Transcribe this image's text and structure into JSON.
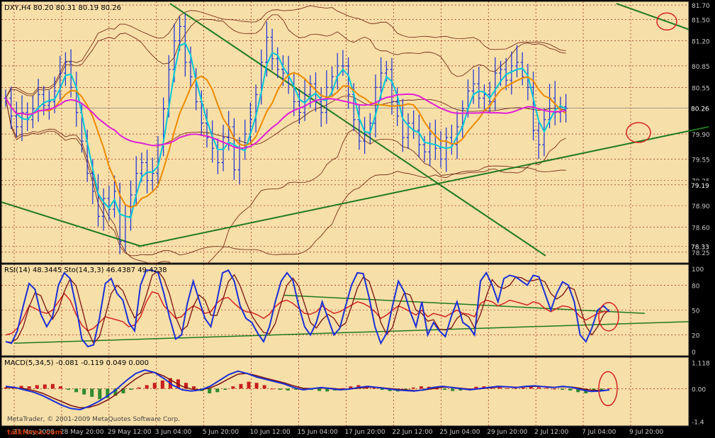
{
  "colors": {
    "background": "#f7dfa8",
    "axis": "#2a2a2a",
    "grid": "#8b0000",
    "candle": "#1a2ed6",
    "trendline": "#1f7a1f",
    "ma_fast": "#00c8d6",
    "ma_mid": "#ee8a00",
    "ma_slow": "#e020d8",
    "bands": "#6a1a0a",
    "rsi": "#d42222",
    "stoch_main": "#1a2ed6",
    "stoch_signal": "#7a1010",
    "macd_up": "#c81e1e",
    "macd_down": "#2e8b2e",
    "annotation": "#d42222",
    "current_price_tag": "#000000"
  },
  "chart_data": [
    {
      "type": "line",
      "panel": "price",
      "title": "DXY,H4  80.20 80.31 80.19 80.26",
      "symbol": "DXY",
      "timeframe": "H4",
      "ohlc": {
        "open": 80.2,
        "high": 80.31,
        "low": 80.19,
        "close": 80.26
      },
      "ylim": [
        78.1,
        81.75
      ],
      "y_ticks": [
        "81.70",
        "81.50",
        "81.20",
        "80.85",
        "80.55",
        "80.26",
        "79.90",
        "79.55",
        "79.25",
        "79.19",
        "78.90",
        "78.60",
        "78.33",
        "78.25"
      ],
      "current_price": "80.26",
      "marked_levels": [
        "79.19",
        "78.33"
      ],
      "x_labels": [
        "27 May 2009",
        "28 May 20:00",
        "29 May 12:00",
        "3 Jun 04:00",
        "5 Jun 20:00",
        "10 Jun 12:00",
        "15 Jun 04:00",
        "17 Jun 20:00",
        "22 Jun 12:00",
        "25 Jun 04:00",
        "29 Jun 20:00",
        "2 Jul 12:00",
        "7 Jul 04:00",
        "9 Jul 20:00"
      ],
      "x": [
        0,
        2,
        4,
        6,
        8,
        10,
        12,
        14,
        16,
        18,
        20,
        22,
        24,
        26,
        28,
        30,
        32,
        34,
        36,
        38,
        40,
        42,
        44,
        46,
        48,
        50,
        52,
        54,
        56,
        58,
        60,
        62,
        64,
        66,
        68,
        70,
        72,
        74,
        76,
        78,
        80,
        82,
        84,
        86,
        88,
        90,
        92,
        94,
        96,
        98,
        100,
        102,
        104,
        106,
        108,
        110,
        112,
        114,
        116,
        118,
        120,
        122,
        124,
        126,
        128,
        130,
        132,
        134,
        136,
        138,
        140,
        142,
        144,
        146,
        148,
        150,
        152,
        154,
        156,
        158,
        160,
        162,
        164,
        166,
        168,
        170,
        172,
        174,
        176,
        178,
        180,
        182,
        184,
        186,
        188,
        190,
        192,
        194,
        196,
        198,
        200,
        202,
        204,
        206,
        208,
        210,
        212,
        214,
        216,
        218,
        220,
        222
      ],
      "close": [
        80.4,
        80.15,
        80.0,
        80.2,
        80.1,
        80.25,
        80.45,
        80.3,
        80.35,
        80.5,
        80.75,
        80.9,
        80.55,
        80.2,
        79.8,
        79.35,
        79.1,
        78.75,
        79.0,
        78.85,
        79.1,
        78.4,
        78.75,
        79.05,
        79.35,
        79.5,
        79.25,
        79.35,
        79.75,
        80.25,
        80.8,
        81.2,
        81.4,
        80.9,
        80.7,
        80.35,
        80.05,
        79.85,
        79.7,
        79.5,
        79.85,
        80.0,
        79.4,
        79.7,
        79.9,
        80.1,
        80.45,
        80.9,
        81.25,
        80.95,
        80.8,
        80.75,
        80.6,
        80.35,
        80.2,
        80.45,
        80.6,
        80.35,
        80.2,
        80.55,
        80.7,
        80.85,
        80.85,
        80.45,
        80.1,
        79.8,
        79.9,
        80.05,
        80.55,
        80.75,
        80.8,
        80.35,
        80.15,
        79.85,
        80.05,
        79.95,
        79.75,
        79.65,
        79.9,
        79.7,
        79.55,
        79.85,
        79.75,
        80.0,
        80.25,
        80.5,
        80.6,
        80.4,
        80.45,
        80.35,
        80.75,
        80.8,
        80.65,
        80.85,
        80.9,
        80.7,
        80.55,
        79.95,
        79.75,
        80.1,
        80.4,
        80.2,
        80.28,
        80.26
      ],
      "annotations": [
        "circle at 81.50",
        "circle at 79.90"
      ],
      "trendlines": [
        "descending resistance from 81.70 through 79.55",
        "ascending support from 78.33 through 80.00",
        "descending line 78.95 to 77.90"
      ]
    },
    {
      "type": "line",
      "panel": "oscillator",
      "title": "RSI(14) 48.3445  Sto(14,3,3) 46.4387 49.4238",
      "rsi_period": 14,
      "rsi_value": 48.3445,
      "stoch_params": "14,3,3",
      "stoch_main_value": 46.4387,
      "stoch_signal_value": 49.4238,
      "ylim": [
        0,
        100
      ],
      "y_ticks": [
        "100",
        "80",
        "50",
        "20",
        "0"
      ],
      "levels": [
        80,
        50,
        20
      ],
      "stoch": [
        12,
        10,
        25,
        55,
        82,
        75,
        45,
        30,
        42,
        80,
        95,
        88,
        55,
        15,
        6,
        8,
        40,
        82,
        88,
        70,
        62,
        35,
        25,
        80,
        98,
        98,
        95,
        70,
        40,
        15,
        20,
        58,
        85,
        62,
        40,
        30,
        60,
        95,
        98,
        85,
        55,
        40,
        35,
        22,
        12,
        30,
        60,
        85,
        95,
        86,
        55,
        30,
        20,
        35,
        60,
        40,
        20,
        28,
        55,
        80,
        95,
        94,
        65,
        30,
        10,
        22,
        55,
        85,
        72,
        48,
        30,
        60,
        20,
        35,
        25,
        18,
        42,
        60,
        35,
        30,
        20,
        85,
        95,
        80,
        60,
        88,
        92,
        90,
        85,
        80,
        92,
        90,
        70,
        50,
        70,
        84,
        80,
        60,
        20,
        12,
        28,
        50,
        55,
        48
      ],
      "rsi": [
        20,
        22,
        28,
        40,
        55,
        52,
        48,
        46,
        50,
        60,
        70,
        62,
        45,
        32,
        25,
        28,
        35,
        42,
        40,
        38,
        36,
        30,
        32,
        42,
        60,
        72,
        70,
        55,
        48,
        40,
        42,
        50,
        55,
        52,
        46,
        48,
        58,
        64,
        65,
        58,
        52,
        48,
        47,
        44,
        40,
        45,
        54,
        60,
        62,
        58,
        52,
        46,
        45,
        48,
        55,
        50,
        46,
        48,
        52,
        56,
        60,
        58,
        54,
        48,
        40,
        44,
        50,
        55,
        52,
        48,
        44,
        50,
        42,
        46,
        44,
        42,
        46,
        50,
        46,
        45,
        42,
        58,
        62,
        60,
        55,
        58,
        62,
        60,
        58,
        56,
        60,
        58,
        52,
        48,
        52,
        55,
        54,
        50,
        42,
        38,
        42,
        46,
        48,
        48
      ],
      "annotation": "circle near 48"
    },
    {
      "type": "bar",
      "panel": "macd",
      "title": "MACD(5,34,5) -0.081 -0.119 0.049 0.000",
      "macd_params": "5,34,5",
      "values_shown": [
        "-0.081",
        "-0.119",
        "0.049",
        "0.000"
      ],
      "ylim": [
        -1.6,
        1.35
      ],
      "y_ticks": [
        "1.118",
        "0.00",
        "-1.4"
      ],
      "histogram": [
        0.05,
        0.08,
        0.12,
        0.1,
        0.15,
        0.18,
        0.2,
        0.1,
        -0.05,
        -0.15,
        -0.25,
        -0.35,
        -0.45,
        -0.4,
        -0.3,
        -0.2,
        -0.05,
        0.05,
        0.15,
        0.25,
        0.35,
        0.45,
        0.4,
        0.25,
        0.1,
        -0.1,
        -0.2,
        -0.15,
        -0.05,
        0.1,
        0.2,
        0.3,
        0.25,
        0.15,
        0.0,
        -0.05,
        -0.08,
        -0.05,
        -0.02,
        -0.05,
        -0.1,
        -0.12,
        -0.08,
        0.02,
        0.1,
        0.15,
        0.12,
        0.05,
        -0.05,
        -0.1,
        -0.12,
        -0.05,
        0.05,
        0.1,
        0.08,
        0.0,
        -0.05,
        -0.1,
        -0.08,
        0.0,
        0.08,
        0.1,
        0.08,
        0.05,
        0.02,
        0.04,
        0.05,
        0.08,
        0.06,
        0.03,
        0.0,
        -0.05,
        -0.08,
        -0.15,
        -0.2,
        -0.12,
        -0.08,
        0.02
      ],
      "macd_line": [
        0.1,
        0.05,
        -0.05,
        -0.15,
        -0.3,
        -0.5,
        -0.7,
        -0.85,
        -0.9,
        -0.75,
        -0.55,
        -0.3,
        0.0,
        0.35,
        0.65,
        0.8,
        0.7,
        0.45,
        0.15,
        -0.05,
        -0.1,
        -0.05,
        0.1,
        0.35,
        0.6,
        0.75,
        0.65,
        0.5,
        0.4,
        0.3,
        0.2,
        0.05,
        -0.05,
        0.0,
        0.05,
        0.0,
        -0.05,
        -0.02,
        0.05,
        0.1,
        0.05,
        0.0,
        -0.05,
        -0.08,
        -0.1,
        -0.05,
        0.05,
        0.1,
        0.05,
        0.0,
        -0.05,
        0.0,
        0.05,
        0.1,
        0.08,
        0.05,
        0.1,
        0.12,
        0.08,
        0.05,
        0.1,
        0.05,
        -0.05,
        -0.12,
        -0.1,
        -0.05
      ],
      "signal_line": [
        0.05,
        0.04,
        0.0,
        -0.08,
        -0.2,
        -0.38,
        -0.55,
        -0.72,
        -0.82,
        -0.8,
        -0.68,
        -0.48,
        -0.22,
        0.12,
        0.42,
        0.65,
        0.7,
        0.55,
        0.32,
        0.1,
        -0.02,
        -0.05,
        0.03,
        0.2,
        0.42,
        0.62,
        0.66,
        0.56,
        0.45,
        0.35,
        0.25,
        0.12,
        0.02,
        0.0,
        0.03,
        0.02,
        -0.02,
        -0.02,
        0.02,
        0.06,
        0.06,
        0.02,
        -0.02,
        -0.05,
        -0.08,
        -0.06,
        0.0,
        0.06,
        0.06,
        0.02,
        -0.02,
        -0.01,
        0.03,
        0.07,
        0.08,
        0.06,
        0.08,
        0.1,
        0.09,
        0.06,
        0.08,
        0.07,
        0.01,
        -0.06,
        -0.08,
        -0.06
      ],
      "annotation": "oval around 0.00"
    }
  ],
  "watermark": {
    "site": "talkforex.com"
  },
  "footer": {
    "copyright": "MetaTrader, © 2001-2009 MetaQuotes Software Corp."
  }
}
